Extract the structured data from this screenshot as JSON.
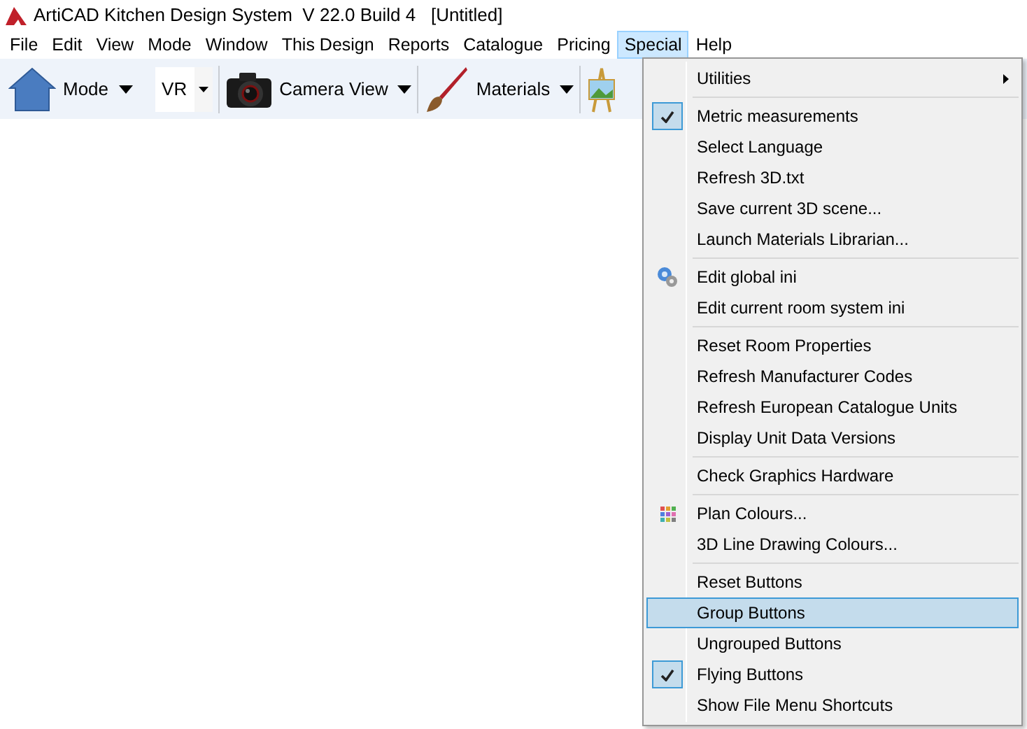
{
  "window": {
    "title": "ArtiCAD Kitchen Design System  V 22.0 Build 4   [Untitled]"
  },
  "menubar": [
    {
      "label": "File",
      "selected": false
    },
    {
      "label": "Edit",
      "selected": false
    },
    {
      "label": "View",
      "selected": false
    },
    {
      "label": "Mode",
      "selected": false
    },
    {
      "label": "Window",
      "selected": false
    },
    {
      "label": "This Design",
      "selected": false
    },
    {
      "label": "Reports",
      "selected": false
    },
    {
      "label": "Catalogue",
      "selected": false
    },
    {
      "label": "Pricing",
      "selected": false
    },
    {
      "label": "Special",
      "selected": true
    },
    {
      "label": "Help",
      "selected": false
    }
  ],
  "toolbar": [
    {
      "kind": "mode",
      "label": "Mode"
    },
    {
      "kind": "vr",
      "label": "VR"
    },
    {
      "kind": "camera",
      "label": "Camera View"
    },
    {
      "kind": "materials",
      "label": "Materials"
    },
    {
      "kind": "easel"
    }
  ],
  "menu": [
    {
      "kind": "submenu",
      "label": "Utilities",
      "selected": false
    },
    {
      "kind": "separator"
    },
    {
      "kind": "toggle",
      "label": "Metric measurements",
      "checked": true,
      "selected": false
    },
    {
      "kind": "command",
      "label": "Select Language",
      "selected": false
    },
    {
      "kind": "command",
      "label": "Refresh 3D.txt",
      "selected": false
    },
    {
      "kind": "command",
      "label": "Save current 3D scene...",
      "selected": false
    },
    {
      "kind": "command",
      "label": "Launch Materials Librarian...",
      "selected": false
    },
    {
      "kind": "separator"
    },
    {
      "kind": "settings",
      "label": "Edit global ini",
      "selected": false
    },
    {
      "kind": "command",
      "label": "Edit current room system ini",
      "selected": false
    },
    {
      "kind": "separator"
    },
    {
      "kind": "command",
      "label": "Reset Room Properties",
      "selected": false
    },
    {
      "kind": "command",
      "label": "Refresh Manufacturer Codes",
      "selected": false
    },
    {
      "kind": "command",
      "label": "Refresh European Catalogue Units",
      "selected": false
    },
    {
      "kind": "command",
      "label": "Display Unit Data Versions",
      "selected": false
    },
    {
      "kind": "separator"
    },
    {
      "kind": "command",
      "label": "Check Graphics Hardware",
      "selected": false
    },
    {
      "kind": "separator"
    },
    {
      "kind": "colours",
      "label": "Plan Colours...",
      "selected": false
    },
    {
      "kind": "command",
      "label": "3D Line Drawing Colours...",
      "selected": false
    },
    {
      "kind": "separator"
    },
    {
      "kind": "command",
      "label": "Reset Buttons",
      "selected": false
    },
    {
      "kind": "command",
      "label": "Group Buttons",
      "selected": true
    },
    {
      "kind": "toggle",
      "label": "Ungrouped Buttons",
      "checked": false,
      "selected": false
    },
    {
      "kind": "toggle",
      "label": "Flying Buttons",
      "checked": true,
      "selected": false
    },
    {
      "kind": "command",
      "label": "Show File Menu Shortcuts",
      "selected": false
    }
  ]
}
